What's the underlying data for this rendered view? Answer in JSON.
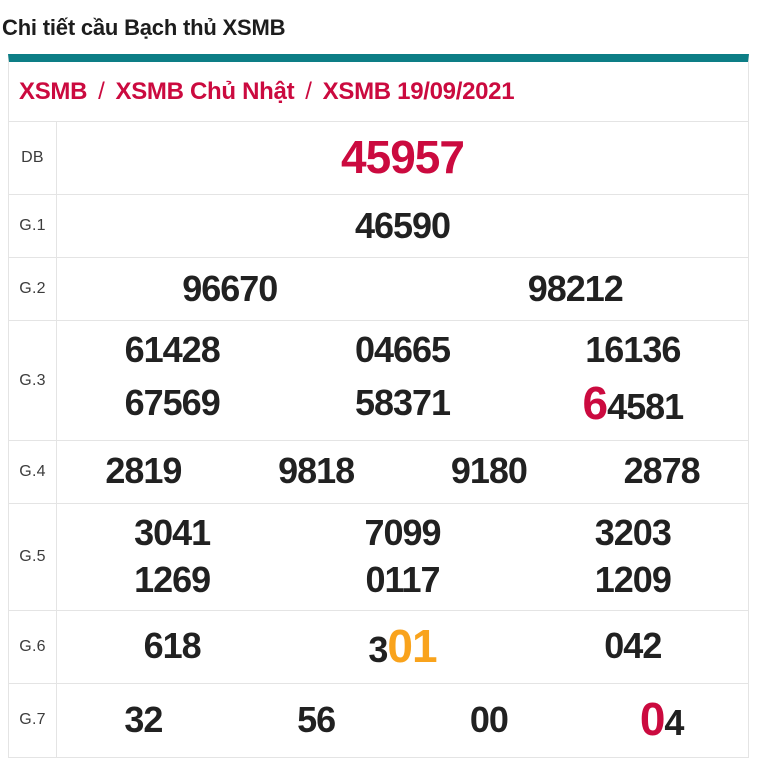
{
  "page_title": "Chi tiết cầu Bạch thủ XSMB",
  "breadcrumb": {
    "separator": "/",
    "items": [
      {
        "label": "XSMB"
      },
      {
        "label": "XSMB Chủ Nhật"
      },
      {
        "label": "XSMB 19/09/2021"
      }
    ]
  },
  "colors": {
    "accent_teal": "#0d7e86",
    "crimson": "#cb0a3f",
    "orange": "#f9a31c",
    "text_dark": "#212121",
    "border_gray": "#e4e4e4"
  },
  "results": {
    "rows": [
      {
        "label": "DB",
        "cols": 1,
        "values": [
          [
            {
              "t": "45957",
              "style": "crimson-big"
            }
          ]
        ]
      },
      {
        "label": "G.1",
        "cols": 1,
        "values": [
          [
            {
              "t": "46590"
            }
          ]
        ]
      },
      {
        "label": "G.2",
        "cols": 2,
        "values": [
          [
            {
              "t": "96670"
            }
          ],
          [
            {
              "t": "98212"
            }
          ]
        ]
      },
      {
        "label": "G.3",
        "cols": 3,
        "values": [
          [
            {
              "t": "61428"
            }
          ],
          [
            {
              "t": "04665"
            }
          ],
          [
            {
              "t": "16136"
            }
          ],
          [
            {
              "t": "67569"
            }
          ],
          [
            {
              "t": "58371"
            }
          ],
          [
            {
              "t": "6",
              "style": "crimson-big"
            },
            {
              "t": "4581"
            }
          ]
        ]
      },
      {
        "label": "G.4",
        "cols": 4,
        "values": [
          [
            {
              "t": "2819"
            }
          ],
          [
            {
              "t": "9818"
            }
          ],
          [
            {
              "t": "9180"
            }
          ],
          [
            {
              "t": "2878"
            }
          ]
        ]
      },
      {
        "label": "G.5",
        "cols": 3,
        "values": [
          [
            {
              "t": "3041"
            }
          ],
          [
            {
              "t": "7099"
            }
          ],
          [
            {
              "t": "3203"
            }
          ],
          [
            {
              "t": "1269"
            }
          ],
          [
            {
              "t": "0117"
            }
          ],
          [
            {
              "t": "1209"
            }
          ]
        ]
      },
      {
        "label": "G.6",
        "cols": 3,
        "values": [
          [
            {
              "t": "618"
            }
          ],
          [
            {
              "t": "3"
            },
            {
              "t": "01",
              "style": "orange-big"
            }
          ],
          [
            {
              "t": "042"
            }
          ]
        ]
      },
      {
        "label": "G.7",
        "cols": 4,
        "values": [
          [
            {
              "t": "32"
            }
          ],
          [
            {
              "t": "56"
            }
          ],
          [
            {
              "t": "00"
            }
          ],
          [
            {
              "t": "0",
              "style": "crimson-big"
            },
            {
              "t": "4"
            }
          ]
        ]
      }
    ]
  }
}
